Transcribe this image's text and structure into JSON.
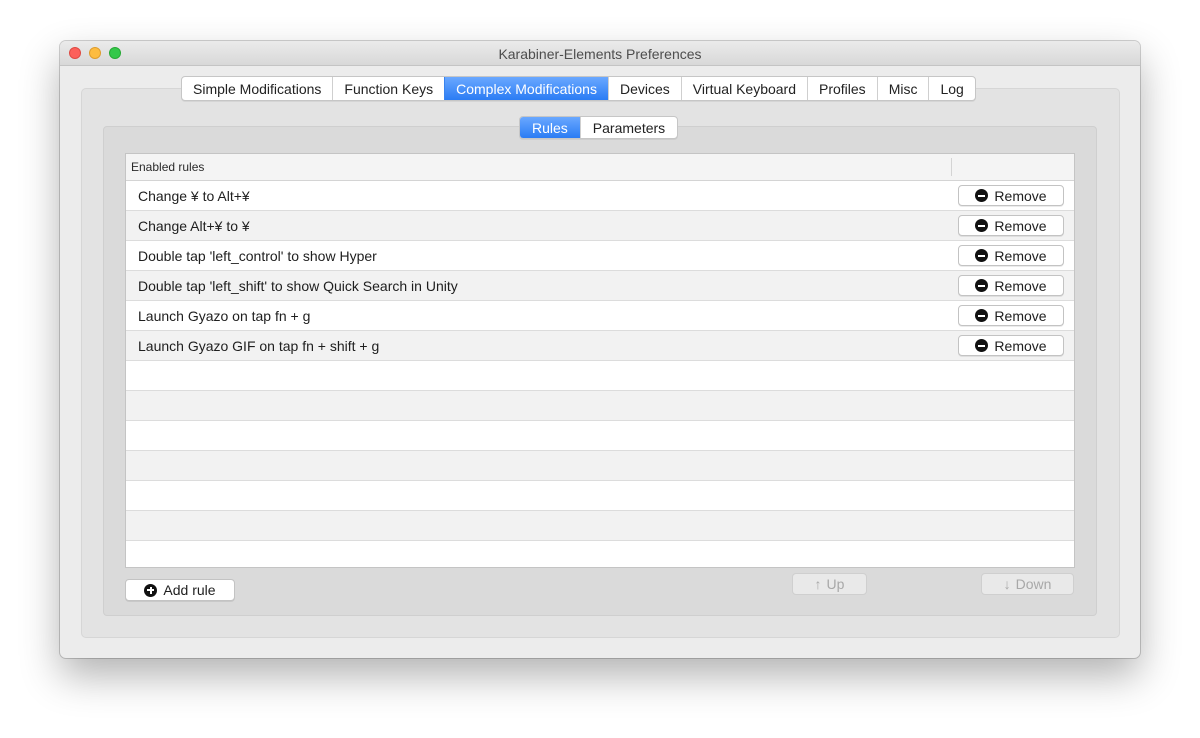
{
  "window": {
    "title": "Karabiner-Elements Preferences"
  },
  "main_tabs": [
    {
      "label": "Simple Modifications",
      "active": false
    },
    {
      "label": "Function Keys",
      "active": false
    },
    {
      "label": "Complex Modifications",
      "active": true
    },
    {
      "label": "Devices",
      "active": false
    },
    {
      "label": "Virtual Keyboard",
      "active": false
    },
    {
      "label": "Profiles",
      "active": false
    },
    {
      "label": "Misc",
      "active": false
    },
    {
      "label": "Log",
      "active": false
    }
  ],
  "sub_tabs": [
    {
      "label": "Rules",
      "active": true
    },
    {
      "label": "Parameters",
      "active": false
    }
  ],
  "table": {
    "header": "Enabled rules",
    "remove_label": "Remove",
    "rules": [
      "Change ¥ to Alt+¥",
      "Change Alt+¥ to ¥",
      "Double tap 'left_control' to show Hyper",
      "Double tap 'left_shift' to show Quick Search in Unity",
      "Launch Gyazo on tap fn + g",
      "Launch Gyazo GIF on tap fn + shift + g"
    ]
  },
  "buttons": {
    "add_rule": "Add rule",
    "up": "Up",
    "down": "Down"
  },
  "colors": {
    "accent": "#2a7cf4",
    "window_bg": "#ececec"
  }
}
